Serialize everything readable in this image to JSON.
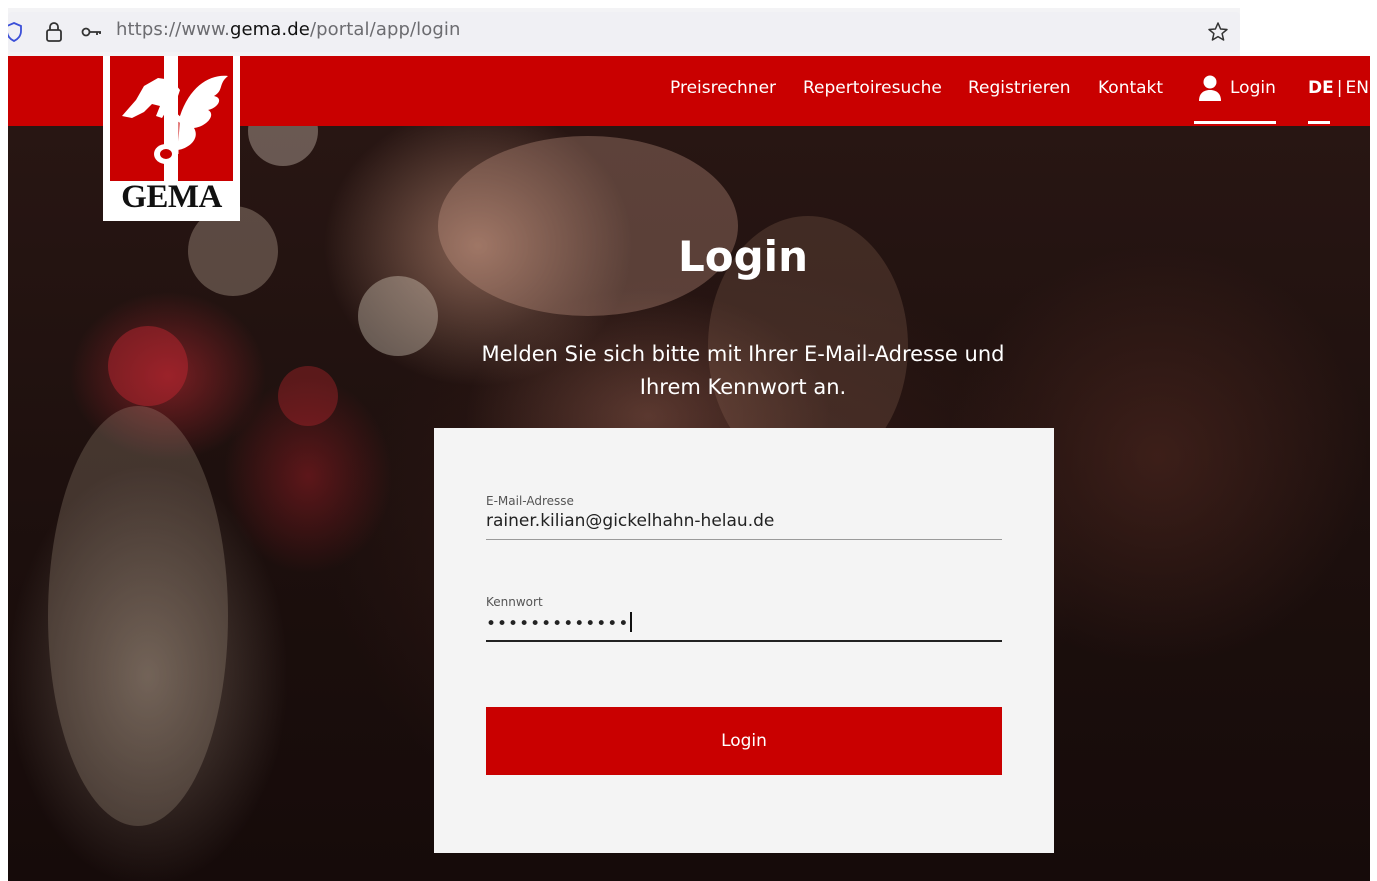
{
  "browser": {
    "url_prefix": "https://www.",
    "url_domain": "gema.de",
    "url_path": "/portal/app/login"
  },
  "logo": {
    "wordmark": "GEMA",
    "brand_color": "#c90000"
  },
  "nav": {
    "items": [
      {
        "label": "Preisrechner"
      },
      {
        "label": "Repertoiresuche"
      },
      {
        "label": "Registrieren"
      },
      {
        "label": "Kontakt"
      }
    ],
    "login_label": "Login",
    "login_icon": "user-icon",
    "lang_active": "DE",
    "lang_separator": "|",
    "lang_other": "EN"
  },
  "hero": {
    "title": "Login",
    "subtitle": "Melden Sie sich bitte mit Ihrer E-Mail-Adresse und Ihrem Kennwort an."
  },
  "form": {
    "email_label": "E-Mail-Adresse",
    "email_value": "rainer.kilian@gickelhahn-helau.de",
    "password_label": "Kennwort",
    "password_masked": "•••••••••••••",
    "submit_label": "Login"
  }
}
